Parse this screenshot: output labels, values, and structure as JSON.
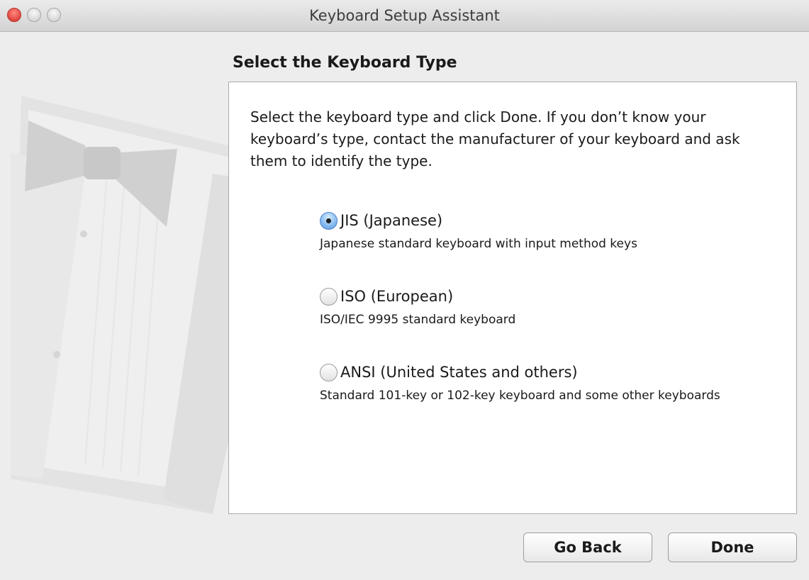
{
  "window": {
    "title": "Keyboard Setup Assistant"
  },
  "heading": "Select the Keyboard Type",
  "intro": "Select the keyboard type and click Done. If you don’t know your keyboard’s type, contact the manufacturer of your keyboard and ask them to identify the type.",
  "options": [
    {
      "label": "JIS (Japanese)",
      "description": "Japanese standard keyboard with input method keys",
      "selected": true
    },
    {
      "label": "ISO (European)",
      "description": "ISO/IEC 9995 standard keyboard",
      "selected": false
    },
    {
      "label": "ANSI (United States and others)",
      "description": "Standard 101-key or 102-key keyboard and some other keyboards",
      "selected": false
    }
  ],
  "buttons": {
    "back": "Go Back",
    "done": "Done"
  },
  "icons": {
    "close": "close-traffic-light",
    "minimize": "minimize-traffic-light",
    "zoom": "zoom-traffic-light",
    "illustration": "tuxedo-bowtie-illustration"
  },
  "colors": {
    "close_light": "#e0443e",
    "selected_radio": "#5c97db"
  }
}
